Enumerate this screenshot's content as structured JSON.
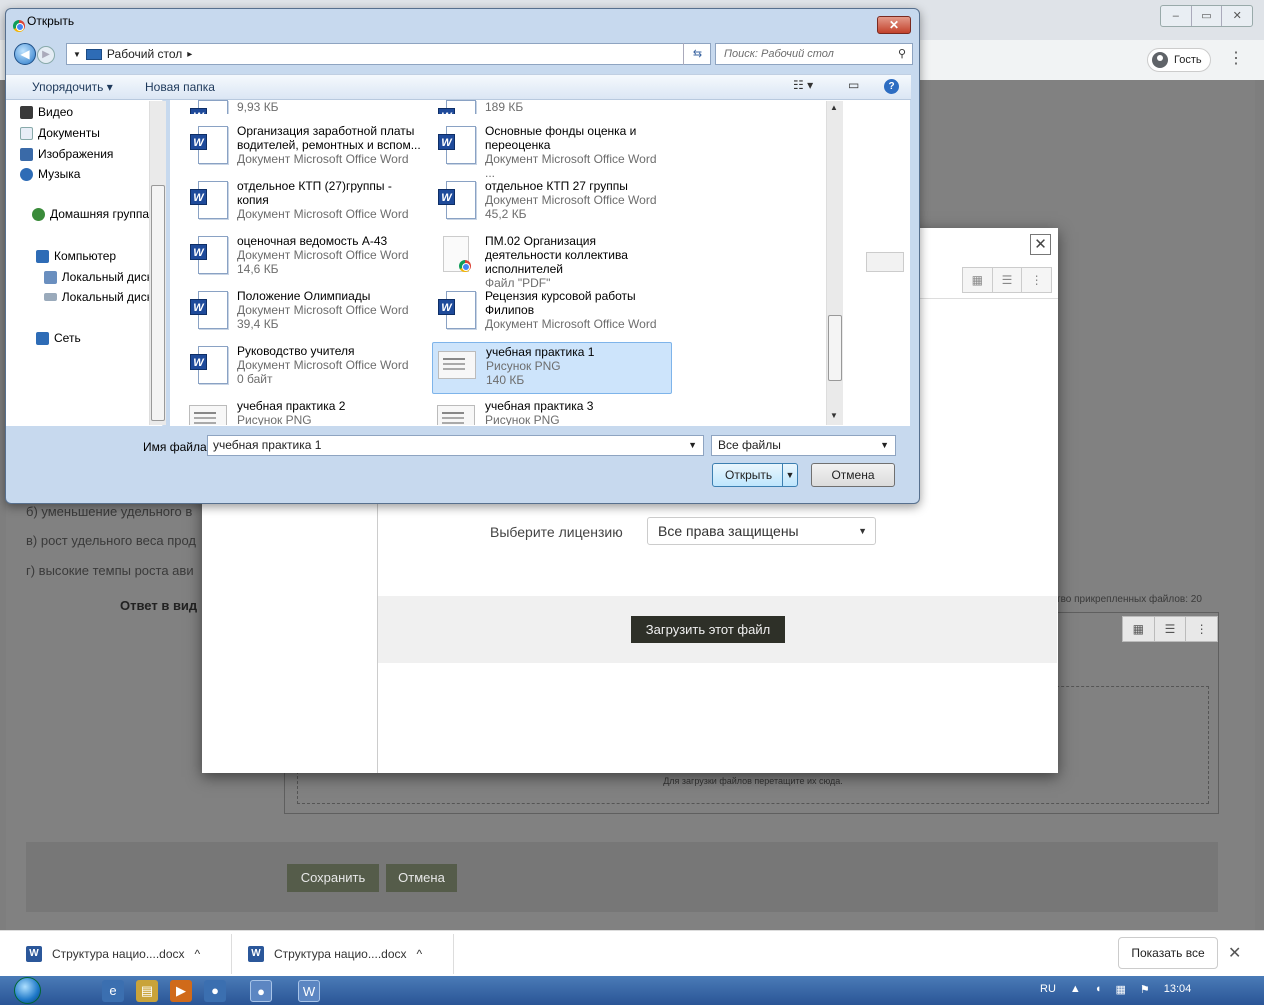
{
  "browser": {
    "window_controls": [
      "–",
      "▭",
      "✕"
    ],
    "guest_label": "Гость",
    "menu": "⋮"
  },
  "page": {
    "question_lines": [
      "б) уменьшение удельного в",
      "в) рост удельного веса прод",
      "г) высокие темпы роста ави"
    ],
    "answer_label": "Ответ в вид",
    "files_count": "тво прикрепленных файлов: 20",
    "dropzone_text": "Для загрузки файлов перетащите их сюда.",
    "save_label": "Сохранить",
    "cancel_label": "Отмена"
  },
  "modal": {
    "close": "✕",
    "license_label": "Выберите лицензию",
    "license_value": "Все права защищены",
    "upload_button": "Загрузить этот файл"
  },
  "dialog": {
    "title": "Открыть",
    "path": "Рабочий стол",
    "search_placeholder": "Поиск: Рабочий стол",
    "organize": "Упорядочить",
    "new_folder": "Новая папка",
    "nav": [
      "Видео",
      "Документы",
      "Изображения",
      "Музыка",
      "Домашняя группа",
      "Компьютер",
      "Локальный диск",
      "Локальный диск",
      "Сеть"
    ],
    "files_col1": [
      {
        "name": "",
        "meta1": "9,93 КБ",
        "meta2": "",
        "type": "word"
      },
      {
        "name": "Организация заработной платы водителей, ремонтных и вспом...",
        "meta1": "Документ Microsoft Office Word",
        "meta2": "",
        "type": "word"
      },
      {
        "name": "отдельное КТП (27)группы - копия",
        "meta1": "Документ Microsoft Office Word",
        "meta2": "",
        "type": "word"
      },
      {
        "name": "оценочная ведомость А-43",
        "meta1": "Документ Microsoft Office Word",
        "meta2": "14,6 КБ",
        "type": "word"
      },
      {
        "name": "Положение  Олимпиады",
        "meta1": "Документ Microsoft Office Word",
        "meta2": "39,4 КБ",
        "type": "word"
      },
      {
        "name": "Руководство учителя",
        "meta1": "Документ Microsoft Office Word",
        "meta2": "0 байт",
        "type": "word"
      },
      {
        "name": "учебная практика 2",
        "meta1": "Рисунок PNG",
        "meta2": "",
        "type": "png"
      }
    ],
    "files_col2": [
      {
        "name": "",
        "meta1": "189 КБ",
        "meta2": "",
        "type": "word"
      },
      {
        "name": "Основные фонды оценка и переоценка",
        "meta1": "Документ Microsoft Office Word ...",
        "meta2": "",
        "type": "word"
      },
      {
        "name": "отдельное КТП 27 группы",
        "meta1": "Документ Microsoft Office Word",
        "meta2": "45,2 КБ",
        "type": "word"
      },
      {
        "name": "ПМ.02 Организация деятельности коллектива исполнителей",
        "meta1": "Файл \"PDF\"",
        "meta2": "",
        "type": "pdf"
      },
      {
        "name": "Рецензия курсовой работы Филипов",
        "meta1": "Документ Microsoft Office Word",
        "meta2": "",
        "type": "word"
      },
      {
        "name": "учебная практика 1",
        "meta1": "Рисунок PNG",
        "meta2": "140 КБ",
        "type": "png",
        "selected": true
      },
      {
        "name": "учебная практика 3",
        "meta1": "Рисунок PNG",
        "meta2": "",
        "type": "png"
      }
    ],
    "filename_label": "Имя файла:",
    "filename_value": "учебная практика 1",
    "filter_value": "Все файлы",
    "open_label": "Открыть",
    "cancel_label": "Отмена"
  },
  "downloads": {
    "items": [
      "Структура нацио....docx",
      "Структура нацио....docx"
    ],
    "show_all": "Показать все",
    "close": "✕"
  },
  "taskbar": {
    "lang": "RU",
    "time": "13:04"
  }
}
